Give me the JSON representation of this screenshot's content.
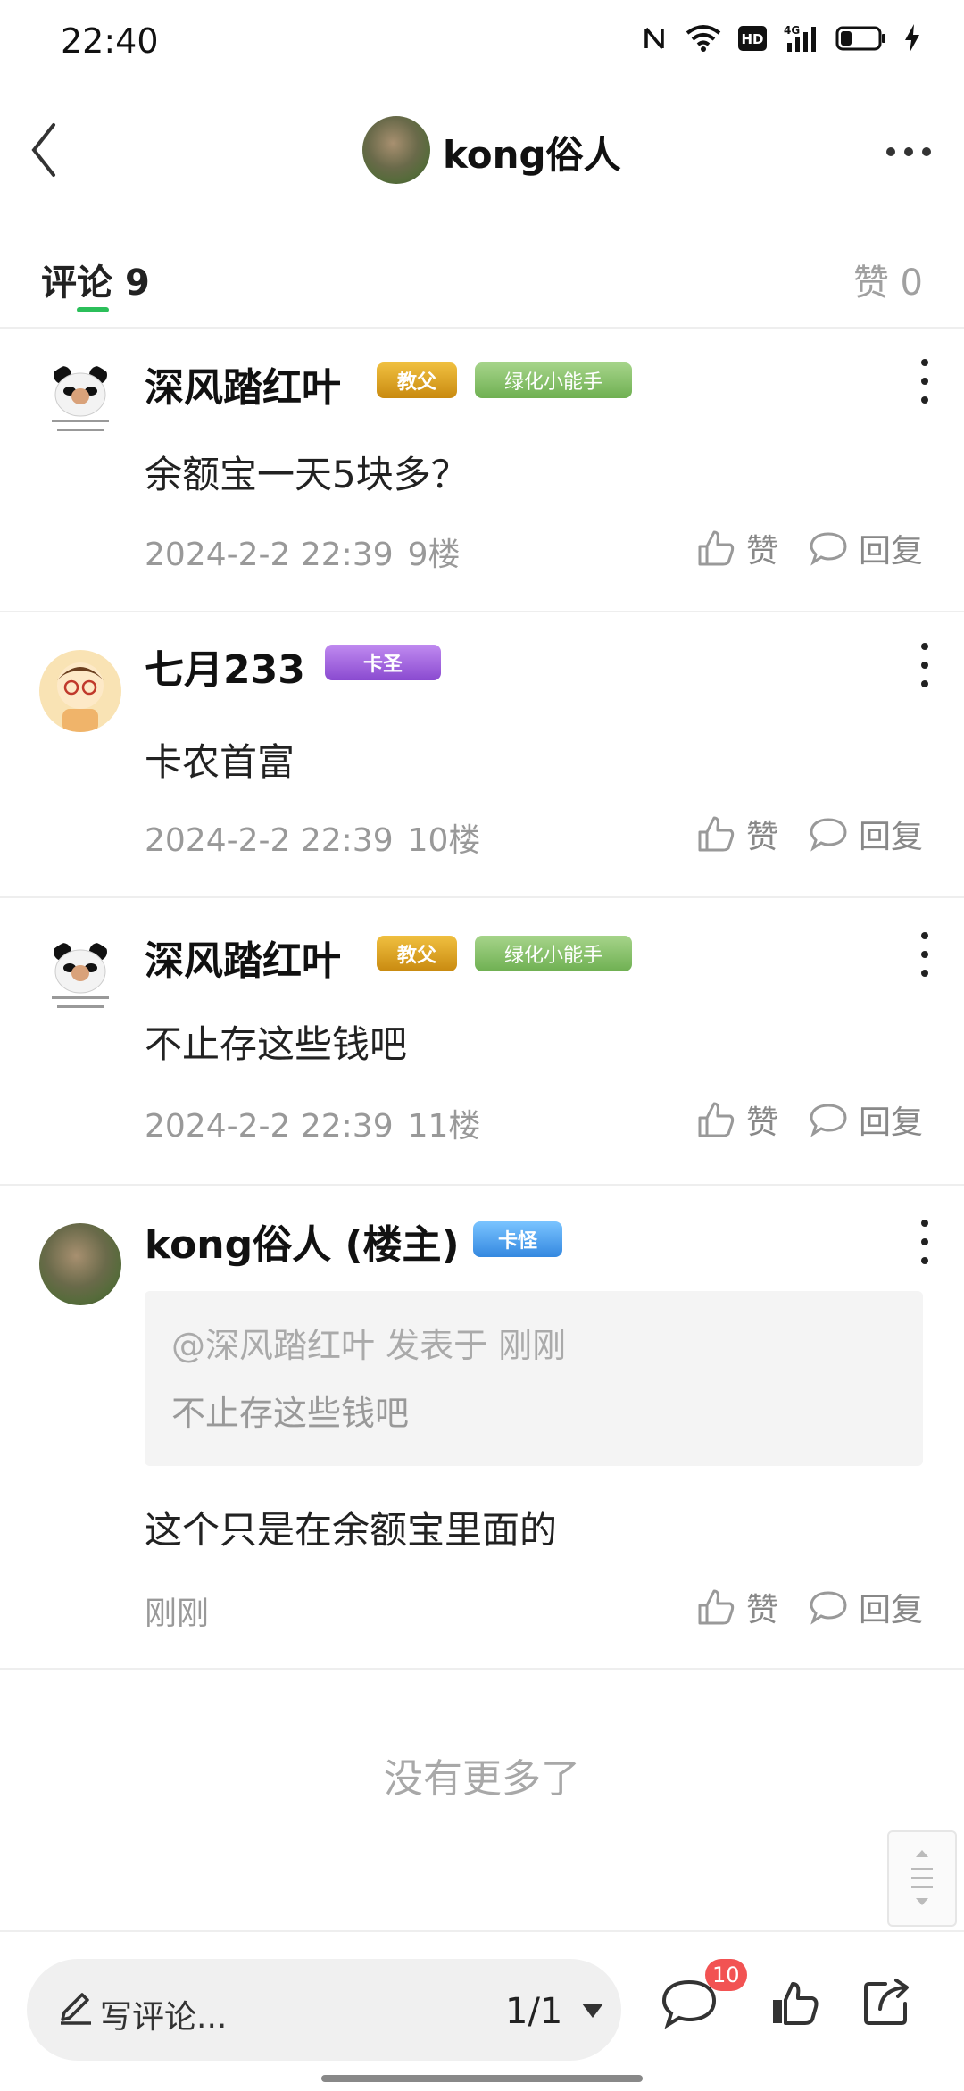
{
  "status_bar": {
    "time": "22:40",
    "icons": [
      "nfc-icon",
      "wifi-icon",
      "hd-icon",
      "signal-4g-icon",
      "battery-icon",
      "charging-icon"
    ]
  },
  "header": {
    "author": "kong俗人"
  },
  "tabs": {
    "comments_label": "评论",
    "comments_count": "9",
    "likes_label": "赞",
    "likes_count": "0",
    "accent": "#2bbf5a"
  },
  "comments": [
    {
      "name": "深风踏红叶",
      "badges": [
        "教父",
        "绿化小能手"
      ],
      "text": "余额宝一天5块多？",
      "date": "2024-2-2 22:39",
      "floor": "9楼"
    },
    {
      "name": "七月233",
      "badges": [
        "卡圣"
      ],
      "text": "卡农首富",
      "date": "2024-2-2 22:39",
      "floor": "10楼"
    },
    {
      "name": "深风踏红叶",
      "badges": [
        "教父",
        "绿化小能手"
      ],
      "text": "不止存这些钱吧",
      "date": "2024-2-2 22:39",
      "floor": "11楼"
    },
    {
      "name": "kong俗人 (楼主)",
      "badges": [
        "卡怪"
      ],
      "quote_author": "@深风踏红叶 发表于 刚刚",
      "quote_text": "不止存这些钱吧",
      "text": "这个只是在余额宝里面的",
      "date": "刚刚"
    }
  ],
  "actions": {
    "like": "赞",
    "reply": "回复"
  },
  "footer": {
    "no_more": "没有更多了"
  },
  "bottom_bar": {
    "write_placeholder": "写评论...",
    "page_indicator": "1/1",
    "comment_count_badge": "10"
  }
}
